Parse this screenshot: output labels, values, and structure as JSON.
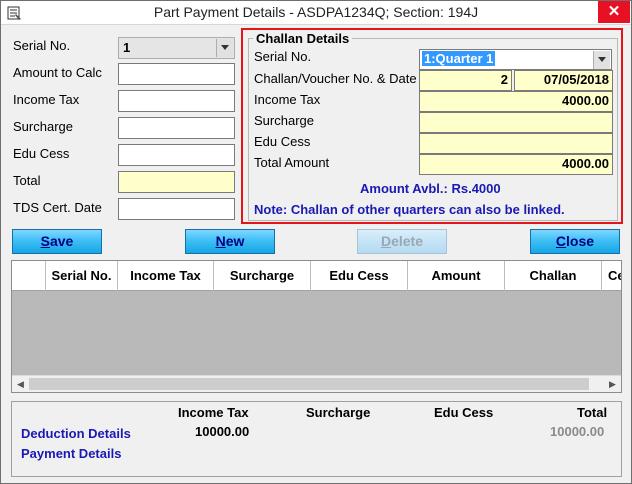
{
  "window": {
    "title": "Part Payment Details - ASDPA1234Q; Section: 194J",
    "close_glyph": "✕"
  },
  "left_form": {
    "serial_no_label": "Serial No.",
    "serial_no_value": "1",
    "amount_to_calc_label": "Amount to Calc",
    "amount_to_calc_value": "",
    "income_tax_label": "Income Tax",
    "income_tax_value": "",
    "surcharge_label": "Surcharge",
    "surcharge_value": "",
    "edu_cess_label": "Edu Cess",
    "edu_cess_value": "",
    "total_label": "Total",
    "total_value": "",
    "tds_cert_date_label": "TDS Cert. Date",
    "tds_cert_date_value": ""
  },
  "challan": {
    "title": "Challan Details",
    "serial_no_label": "Serial No.",
    "serial_no_value": "1:Quarter 1",
    "voucher_label": "Challan/Voucher No. & Date",
    "voucher_no": "2",
    "voucher_date": "07/05/2018",
    "income_tax_label": "Income Tax",
    "income_tax_value": "4000.00",
    "surcharge_label": "Surcharge",
    "surcharge_value": "",
    "edu_cess_label": "Edu Cess",
    "edu_cess_value": "",
    "total_amount_label": "Total Amount",
    "total_amount_value": "4000.00",
    "amount_avbl": "Amount Avbl.: Rs.4000",
    "note": "Note: Challan of other quarters can also be linked."
  },
  "buttons": {
    "save_first": "S",
    "save_rest": "ave",
    "new_first": "N",
    "new_rest": "ew",
    "delete_first": "D",
    "delete_rest": "elete",
    "close_first": "C",
    "close_rest": "lose"
  },
  "grid": {
    "columns": [
      "Serial No.",
      "Income Tax",
      "Surcharge",
      "Edu Cess",
      "Amount",
      "Challan",
      "Ce"
    ],
    "rows": []
  },
  "summary": {
    "headers": {
      "income_tax": "Income Tax",
      "surcharge": "Surcharge",
      "edu_cess": "Edu Cess",
      "total": "Total"
    },
    "deduction_label": "Deduction Details",
    "deduction_income_tax": "10000.00",
    "deduction_total": "10000.00",
    "payment_label": "Payment Details"
  },
  "colors": {
    "highlight_border": "#e3151a",
    "link_blue": "#1a19b4",
    "button_blue": "#16a6e6",
    "yellow_field": "#ffffcc"
  }
}
